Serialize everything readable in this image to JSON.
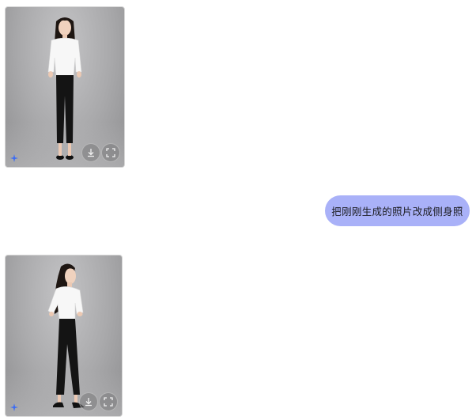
{
  "messages": [
    {
      "role": "assistant",
      "type": "image",
      "pose": "front",
      "actions": {
        "download_icon": "download-icon",
        "fullscreen_icon": "fullscreen-icon"
      },
      "badge_icon": "sparkle-icon"
    },
    {
      "role": "user",
      "type": "text",
      "text": "把刚刚生成的照片改成侧身照"
    },
    {
      "role": "assistant",
      "type": "image",
      "pose": "side",
      "actions": {
        "download_icon": "download-icon",
        "fullscreen_icon": "fullscreen-icon"
      },
      "badge_icon": "sparkle-icon"
    }
  ],
  "colors": {
    "user_bubble": "#a9b1f8",
    "sparkle": "#3b6cf5"
  }
}
